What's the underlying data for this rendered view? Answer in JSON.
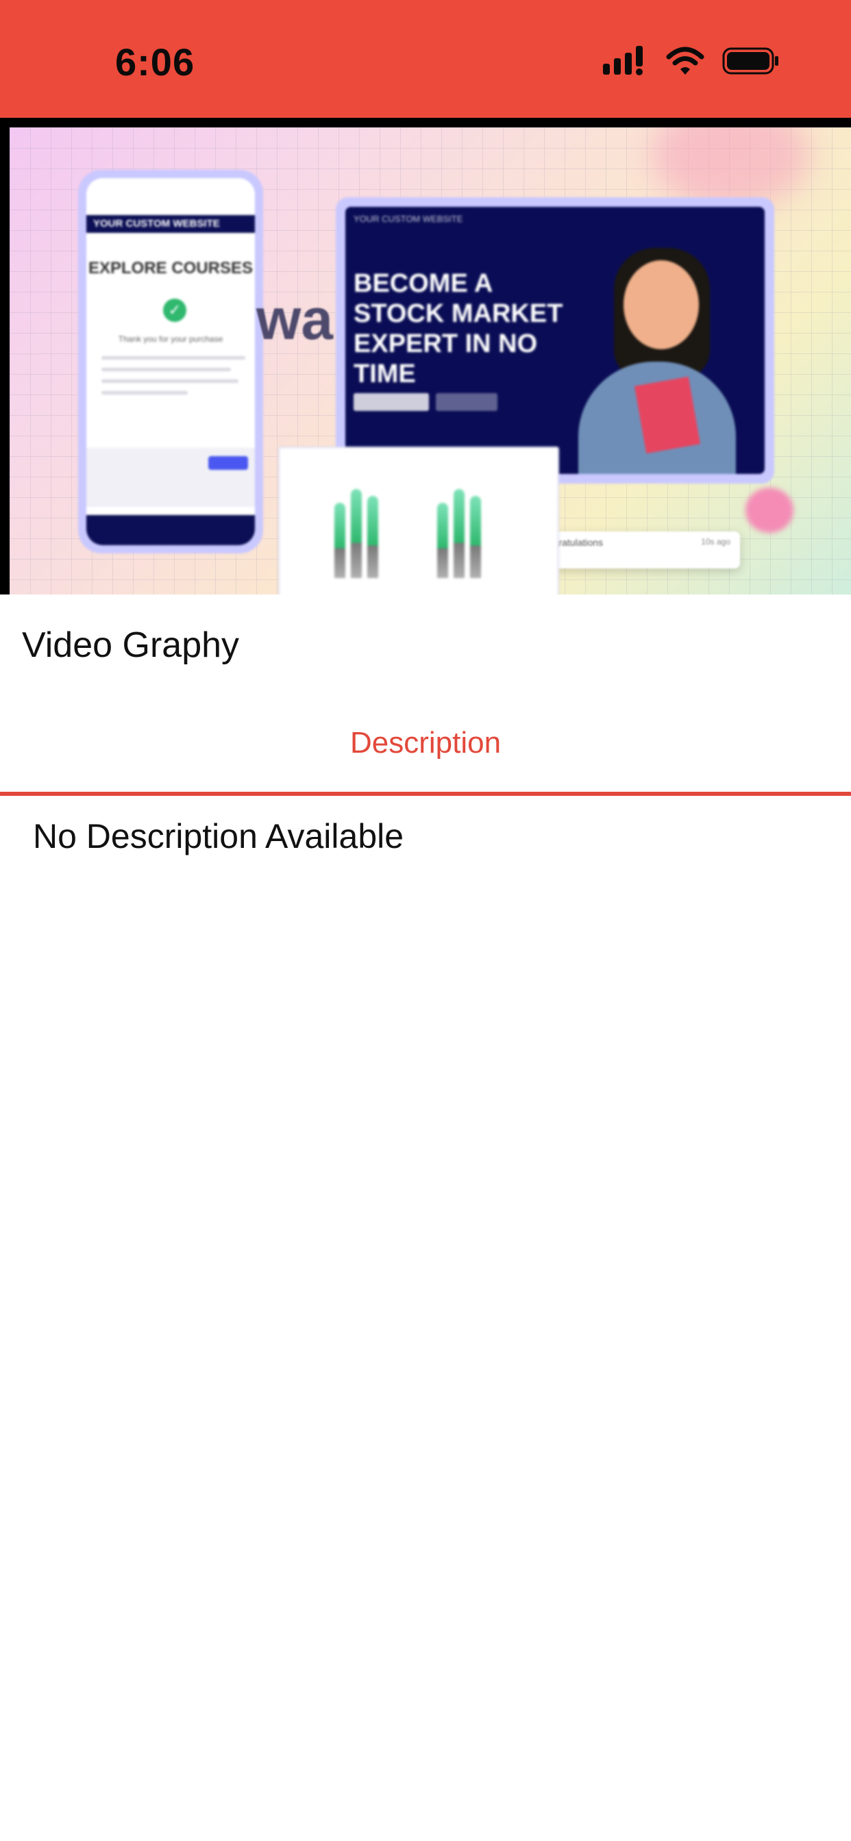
{
  "status_bar": {
    "time": "6:06",
    "icons": [
      "signal-icon",
      "wifi-icon",
      "battery-icon"
    ],
    "background_color": "#ec4a3a"
  },
  "media": {
    "thumbnail_icon": "course-thumbnail",
    "overlay_text": "wa",
    "phone_mockup": {
      "header": "YOUR CUSTOM WEBSITE",
      "title": "EXPLORE COURSES",
      "thanks_text": "Thank you for your purchase"
    },
    "desktop_mockup": {
      "nav": "YOUR CUSTOM WEBSITE",
      "headline": "BECOME A STOCK MARKET EXPERT IN NO TIME"
    },
    "toast": {
      "text": "Congratulations",
      "time": "10s ago"
    }
  },
  "course": {
    "title": "Video Graphy"
  },
  "tabs": [
    {
      "label": "Description",
      "active": true
    }
  ],
  "description": {
    "text": "No Description Available"
  },
  "colors": {
    "accent": "#e2483a",
    "status_bar": "#ec4a3a",
    "text": "#111111"
  }
}
